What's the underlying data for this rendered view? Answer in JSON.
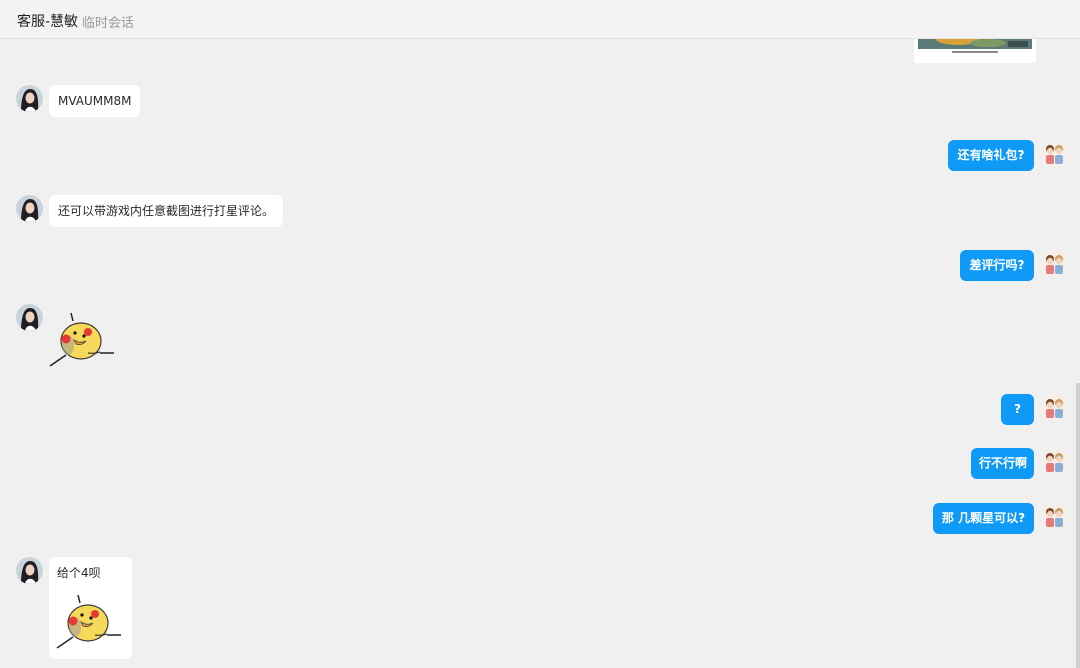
{
  "header": {
    "title": "客服-慧敏",
    "subtitle": "临时会话"
  },
  "messages": {
    "m1": "MVAUMM8M",
    "m2": "还有啥礼包?",
    "m3": "还可以带游戏内任意截图进行打星评论。",
    "m4": "差评行吗?",
    "m6": "?",
    "m7": "行不行啊",
    "m8": "那 几颗星可以?",
    "m9": "给个4呗"
  },
  "colors": {
    "background": "#f0f0f0",
    "outgoing_bubble": "#0f9af7",
    "incoming_bubble": "#ffffff"
  },
  "icons": {
    "agent_avatar": "woman-portrait-avatar",
    "user_avatar": "cartoon-couple-avatar",
    "sticker": "yellow-chick-sticker"
  }
}
